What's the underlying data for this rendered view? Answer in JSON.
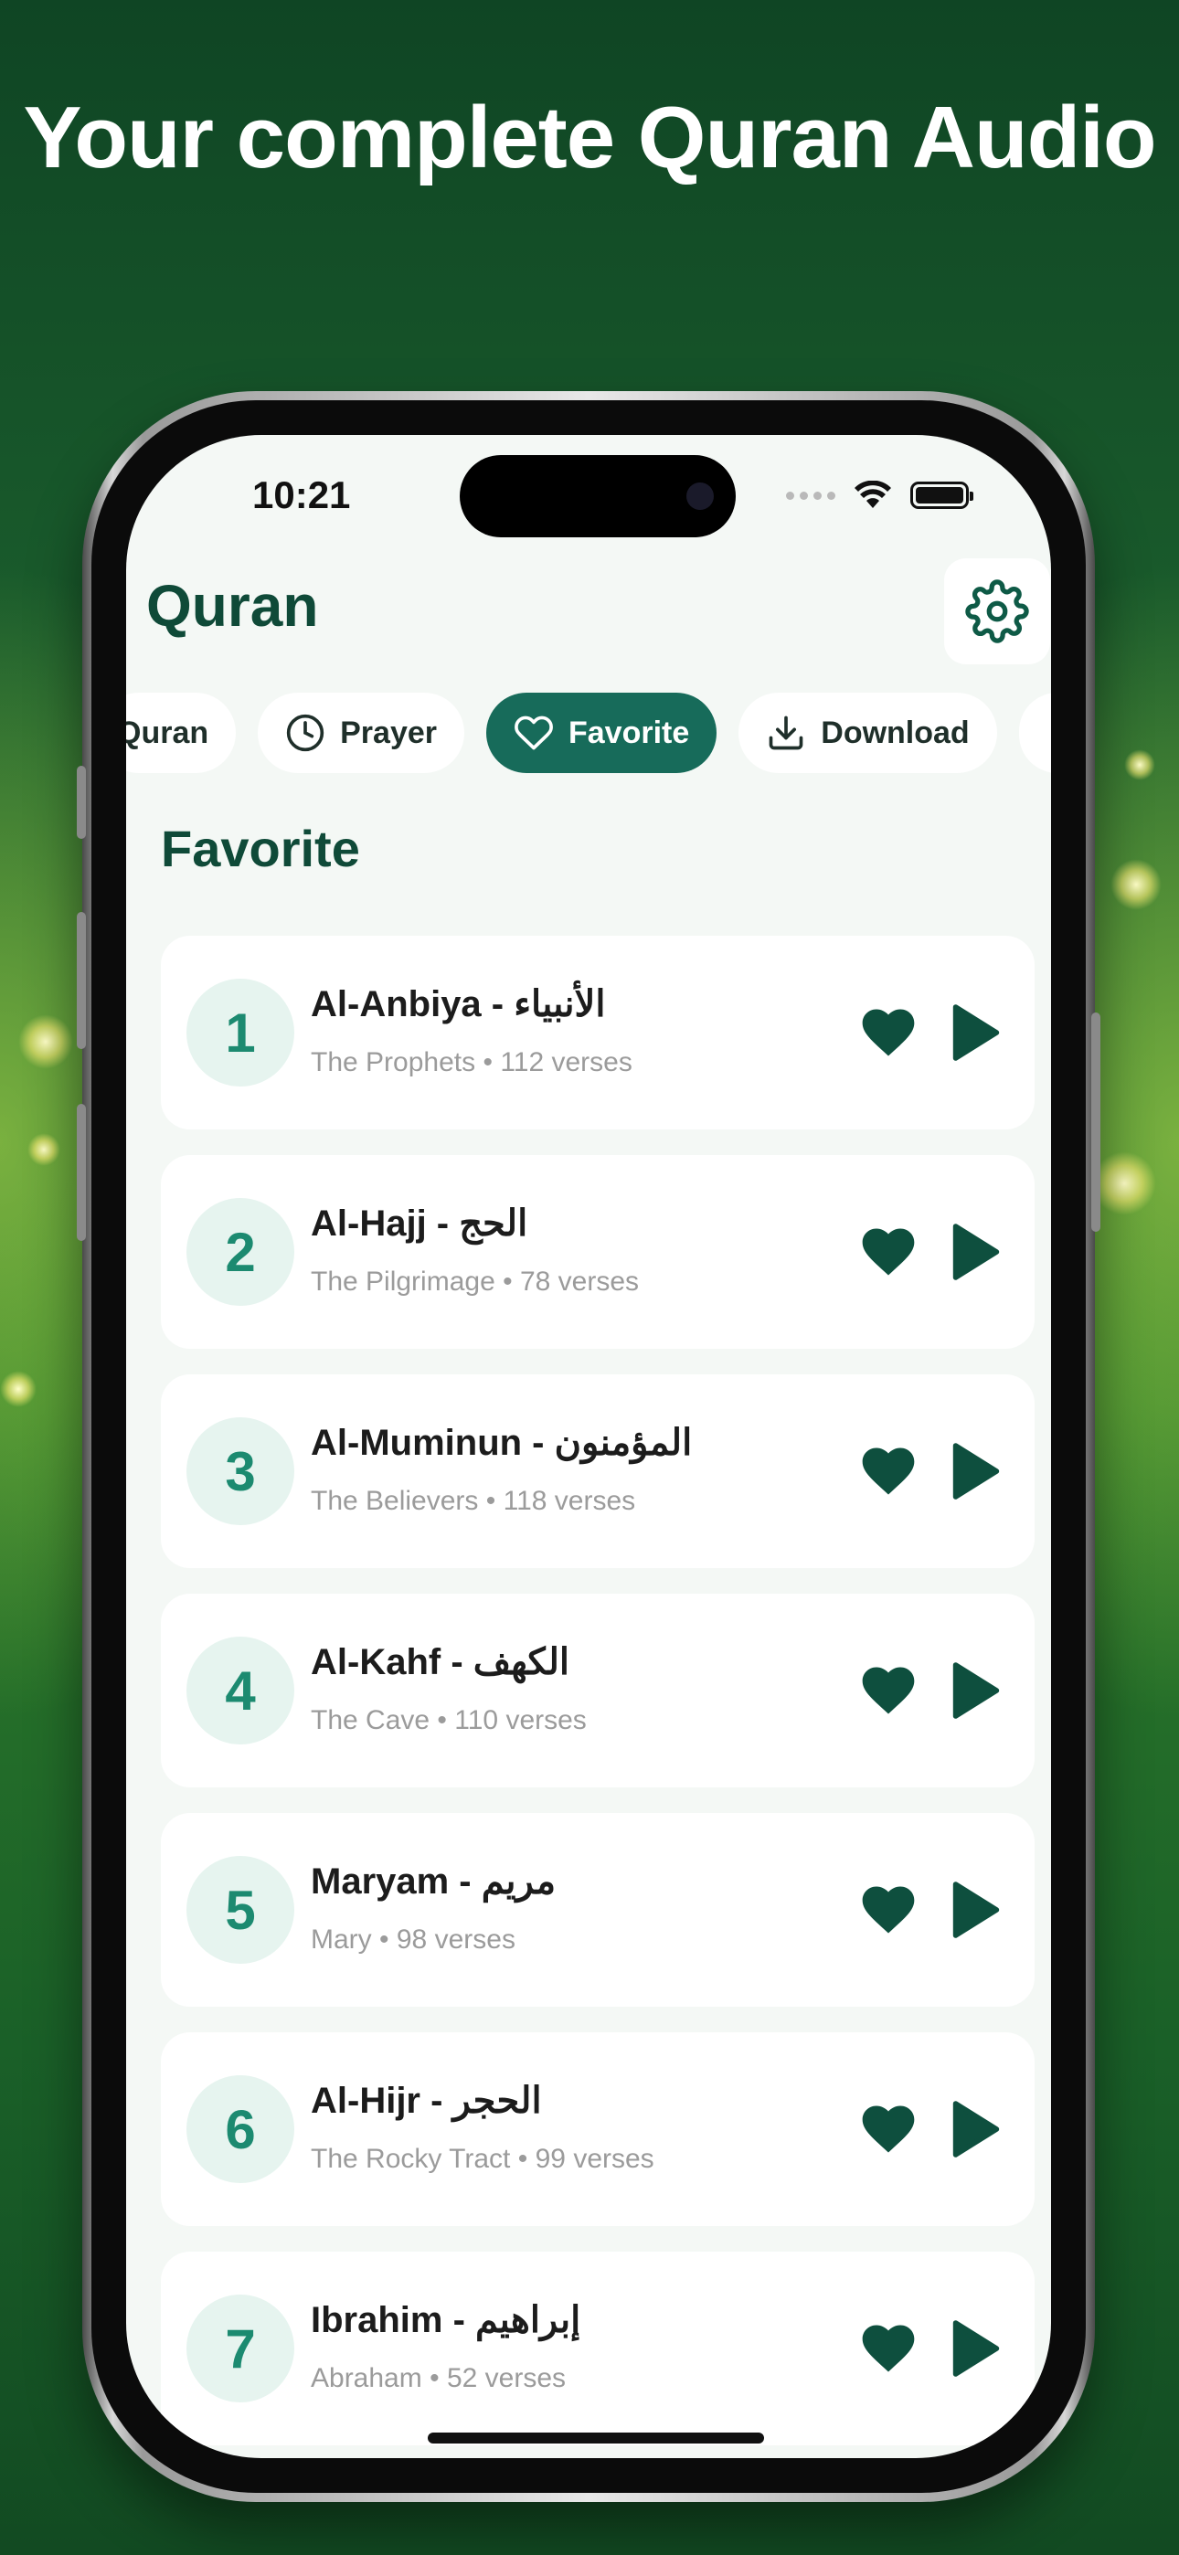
{
  "headline": "Your complete Quran Audio",
  "status_bar": {
    "time": "10:21"
  },
  "app": {
    "title": "Quran"
  },
  "tabs": [
    {
      "label": "Quran",
      "icon": "book-icon",
      "active": false
    },
    {
      "label": "Prayer",
      "icon": "clock-icon",
      "active": false
    },
    {
      "label": "Favorite",
      "icon": "heart-outline-icon",
      "active": true
    },
    {
      "label": "Download",
      "icon": "download-icon",
      "active": false
    },
    {
      "label": "",
      "icon": "mosque-icon",
      "active": false
    }
  ],
  "section_title": "Favorite",
  "favorites": [
    {
      "number": "1",
      "name": "Al-Anbiya - الأنبياء",
      "meaning": "The Prophets",
      "verses": "112 verses"
    },
    {
      "number": "2",
      "name": "Al-Hajj - الحج",
      "meaning": "The Pilgrimage",
      "verses": "78 verses"
    },
    {
      "number": "3",
      "name": "Al-Muminun - المؤمنون",
      "meaning": "The Believers",
      "verses": "118 verses"
    },
    {
      "number": "4",
      "name": "Al-Kahf - الكهف",
      "meaning": "The Cave",
      "verses": "110 verses"
    },
    {
      "number": "5",
      "name": "Maryam - مريم",
      "meaning": "Mary",
      "verses": "98 verses"
    },
    {
      "number": "6",
      "name": "Al-Hijr - الحجر",
      "meaning": "The Rocky Tract",
      "verses": "99 verses"
    },
    {
      "number": "7",
      "name": "Ibrahim - إبراهيم",
      "meaning": "Abraham",
      "verses": "52 verses"
    }
  ],
  "separator": "•",
  "colors": {
    "accent": "#176b5a",
    "title": "#0f4a38",
    "number": "#1c8a70",
    "number_bg": "#e6f4ef",
    "icon": "#0e4f3e"
  }
}
